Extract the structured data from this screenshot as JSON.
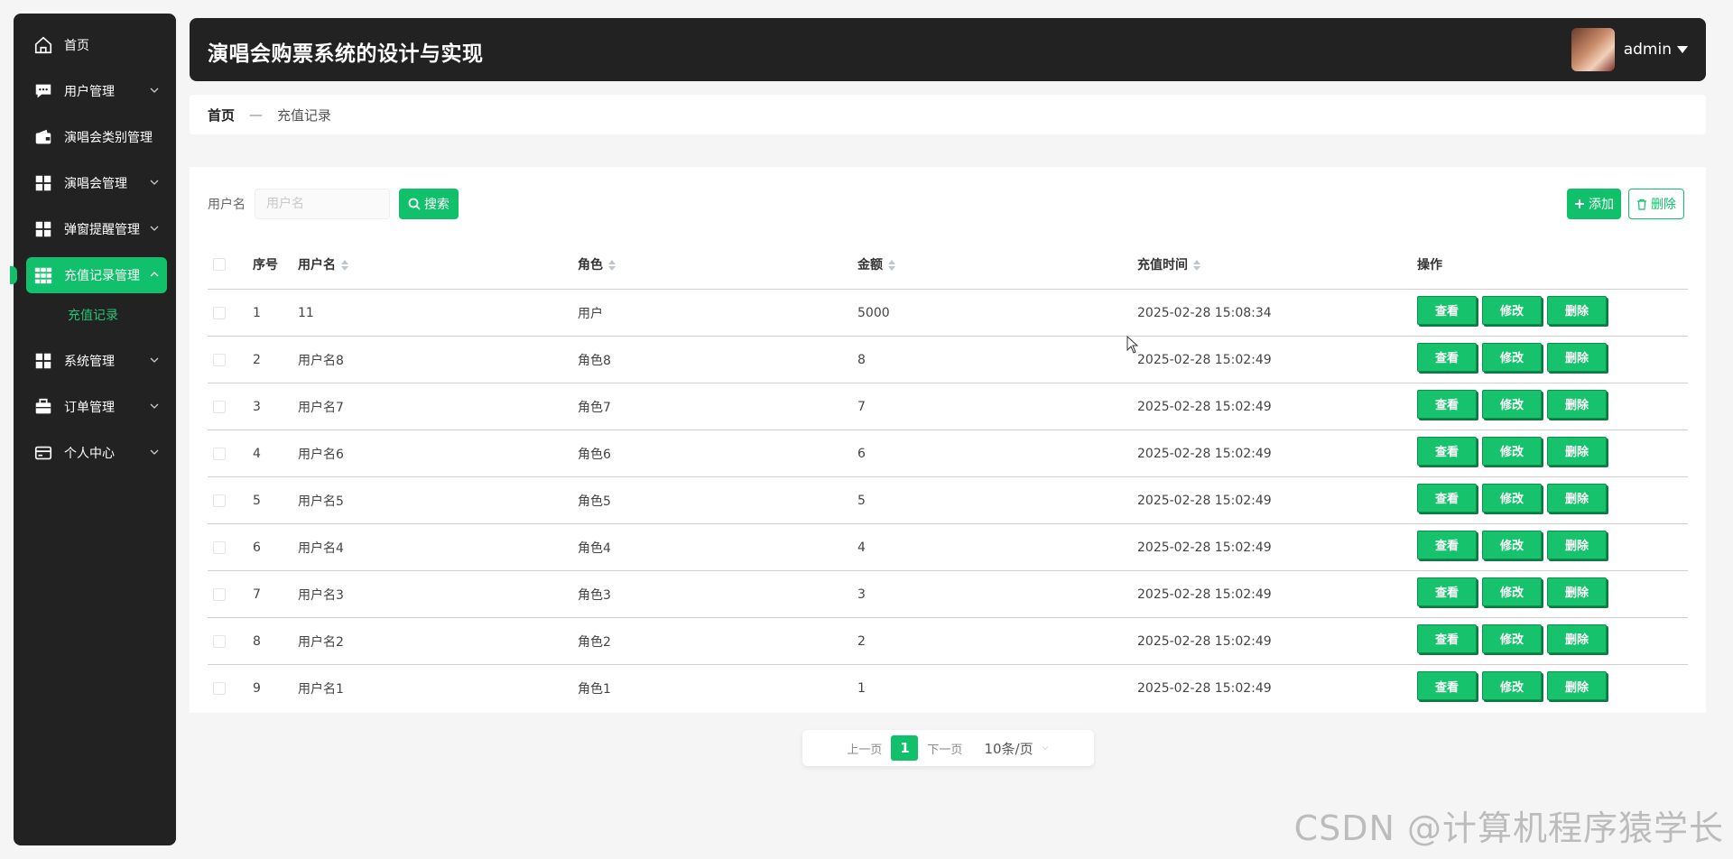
{
  "app": {
    "title": "演唱会购票系统的设计与实现",
    "user": "admin"
  },
  "sidebar": {
    "items": [
      {
        "label": "首页",
        "icon": "home-icon"
      },
      {
        "label": "用户管理",
        "icon": "chat-icon"
      },
      {
        "label": "演唱会类别管理",
        "icon": "wallet-icon"
      },
      {
        "label": "演唱会管理",
        "icon": "grid-icon"
      },
      {
        "label": "弹窗提醒管理",
        "icon": "grid-icon"
      },
      {
        "label": "充值记录管理",
        "icon": "apps-icon",
        "active": true
      },
      {
        "label": "系统管理",
        "icon": "grid-icon"
      },
      {
        "label": "订单管理",
        "icon": "briefcase-icon"
      },
      {
        "label": "个人中心",
        "icon": "card-icon"
      }
    ],
    "sub_item": "充值记录"
  },
  "breadcrumb": {
    "home": "首页",
    "separator": "—",
    "current": "充值记录"
  },
  "search": {
    "label": "用户名",
    "placeholder": "用户名",
    "button": "搜索"
  },
  "actions": {
    "add": "添加",
    "delete": "删除"
  },
  "table": {
    "headers": {
      "index": "序号",
      "user": "用户名",
      "role": "角色",
      "amount": "金额",
      "time": "充值时间",
      "ops": "操作"
    },
    "op_labels": {
      "view": "查看",
      "edit": "修改",
      "delete": "删除"
    },
    "rows": [
      {
        "index": "1",
        "user": "11",
        "role": "用户",
        "amount": "5000",
        "time": "2025-02-28 15:08:34"
      },
      {
        "index": "2",
        "user": "用户名8",
        "role": "角色8",
        "amount": "8",
        "time": "2025-02-28 15:02:49"
      },
      {
        "index": "3",
        "user": "用户名7",
        "role": "角色7",
        "amount": "7",
        "time": "2025-02-28 15:02:49"
      },
      {
        "index": "4",
        "user": "用户名6",
        "role": "角色6",
        "amount": "6",
        "time": "2025-02-28 15:02:49"
      },
      {
        "index": "5",
        "user": "用户名5",
        "role": "角色5",
        "amount": "5",
        "time": "2025-02-28 15:02:49"
      },
      {
        "index": "6",
        "user": "用户名4",
        "role": "角色4",
        "amount": "4",
        "time": "2025-02-28 15:02:49"
      },
      {
        "index": "7",
        "user": "用户名3",
        "role": "角色3",
        "amount": "3",
        "time": "2025-02-28 15:02:49"
      },
      {
        "index": "8",
        "user": "用户名2",
        "role": "角色2",
        "amount": "2",
        "time": "2025-02-28 15:02:49"
      },
      {
        "index": "9",
        "user": "用户名1",
        "role": "角色1",
        "amount": "1",
        "time": "2025-02-28 15:02:49"
      }
    ]
  },
  "pagination": {
    "prev": "上一页",
    "current": "1",
    "next": "下一页",
    "page_size": "10条/页"
  },
  "watermark": "CSDN @计算机程序猿学长",
  "colors": {
    "accent": "#10c06a",
    "dark": "#222222"
  }
}
